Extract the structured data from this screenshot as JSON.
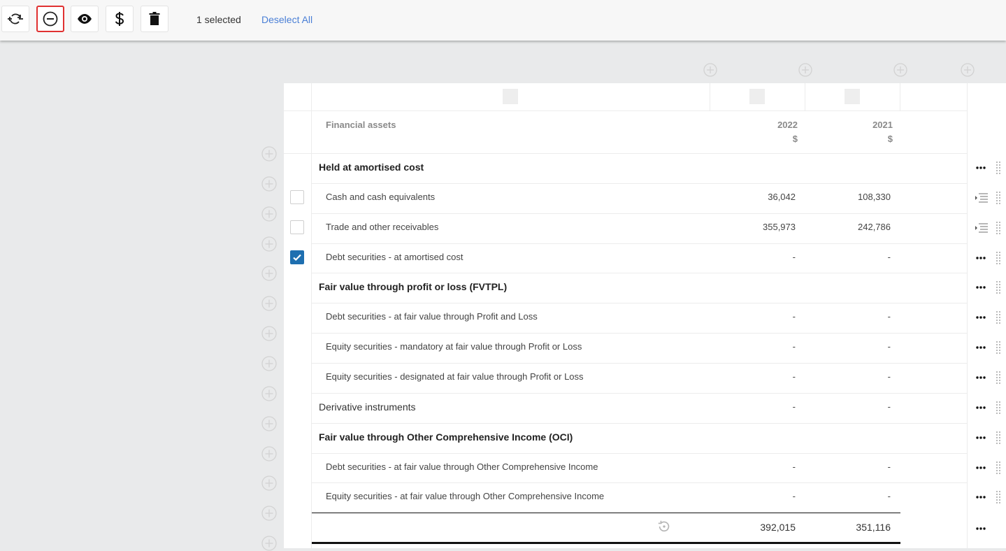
{
  "toolbar": {
    "buttons": [
      {
        "name": "convert-icon"
      },
      {
        "name": "remove-circle-icon",
        "active": true
      },
      {
        "name": "eye-icon"
      },
      {
        "name": "dollar-icon"
      },
      {
        "name": "trash-icon"
      }
    ],
    "selected_count": "1 selected",
    "deselect_label": "Deselect All"
  },
  "table": {
    "header": {
      "label": "Financial assets",
      "col1_year": "2022",
      "col1_unit": "$",
      "col2_year": "2021",
      "col2_unit": "$"
    },
    "rows": [
      {
        "label": "Held at amortised cost",
        "style": "bold",
        "v1": "",
        "v2": "",
        "checkbox": "none",
        "action": "more"
      },
      {
        "label": "Cash and cash equivalents",
        "style": "indent",
        "v1": "36,042",
        "v2": "108,330",
        "checkbox": "unchecked",
        "action": "indent"
      },
      {
        "label": "Trade and other receivables",
        "style": "indent",
        "v1": "355,973",
        "v2": "242,786",
        "checkbox": "unchecked",
        "action": "indent"
      },
      {
        "label": "Debt securities - at amortised cost",
        "style": "indent",
        "v1": "-",
        "v2": "-",
        "checkbox": "checked",
        "action": "more"
      },
      {
        "label": "Fair value through profit or loss (FVTPL)",
        "style": "bold",
        "v1": "",
        "v2": "",
        "checkbox": "none",
        "action": "more"
      },
      {
        "label": "Debt securities - at fair value through Profit and Loss",
        "style": "indent",
        "v1": "-",
        "v2": "-",
        "checkbox": "none",
        "action": "more"
      },
      {
        "label": "Equity securities - mandatory at fair value through Profit or Loss",
        "style": "indent",
        "v1": "-",
        "v2": "-",
        "checkbox": "none",
        "action": "more"
      },
      {
        "label": "Equity securities - designated at fair value through Profit or Loss",
        "style": "indent",
        "v1": "-",
        "v2": "-",
        "checkbox": "none",
        "action": "more"
      },
      {
        "label": "Derivative instruments",
        "style": "plain",
        "v1": "-",
        "v2": "-",
        "checkbox": "none",
        "action": "more"
      },
      {
        "label": "Fair value through Other Comprehensive Income (OCI)",
        "style": "bold",
        "v1": "",
        "v2": "",
        "checkbox": "none",
        "action": "more"
      },
      {
        "label": "Debt securities - at fair value through Other Comprehensive Income",
        "style": "indent",
        "v1": "-",
        "v2": "-",
        "checkbox": "none",
        "action": "more"
      },
      {
        "label": "Equity securities - at fair value through Other Comprehensive Income",
        "style": "indent",
        "v1": "-",
        "v2": "-",
        "checkbox": "none",
        "action": "more"
      }
    ],
    "total": {
      "v1": "392,015",
      "v2": "351,116"
    }
  },
  "colors": {
    "accent": "#4a7fd6",
    "checkbox": "#1e6fb0",
    "active_border": "#e03131"
  }
}
